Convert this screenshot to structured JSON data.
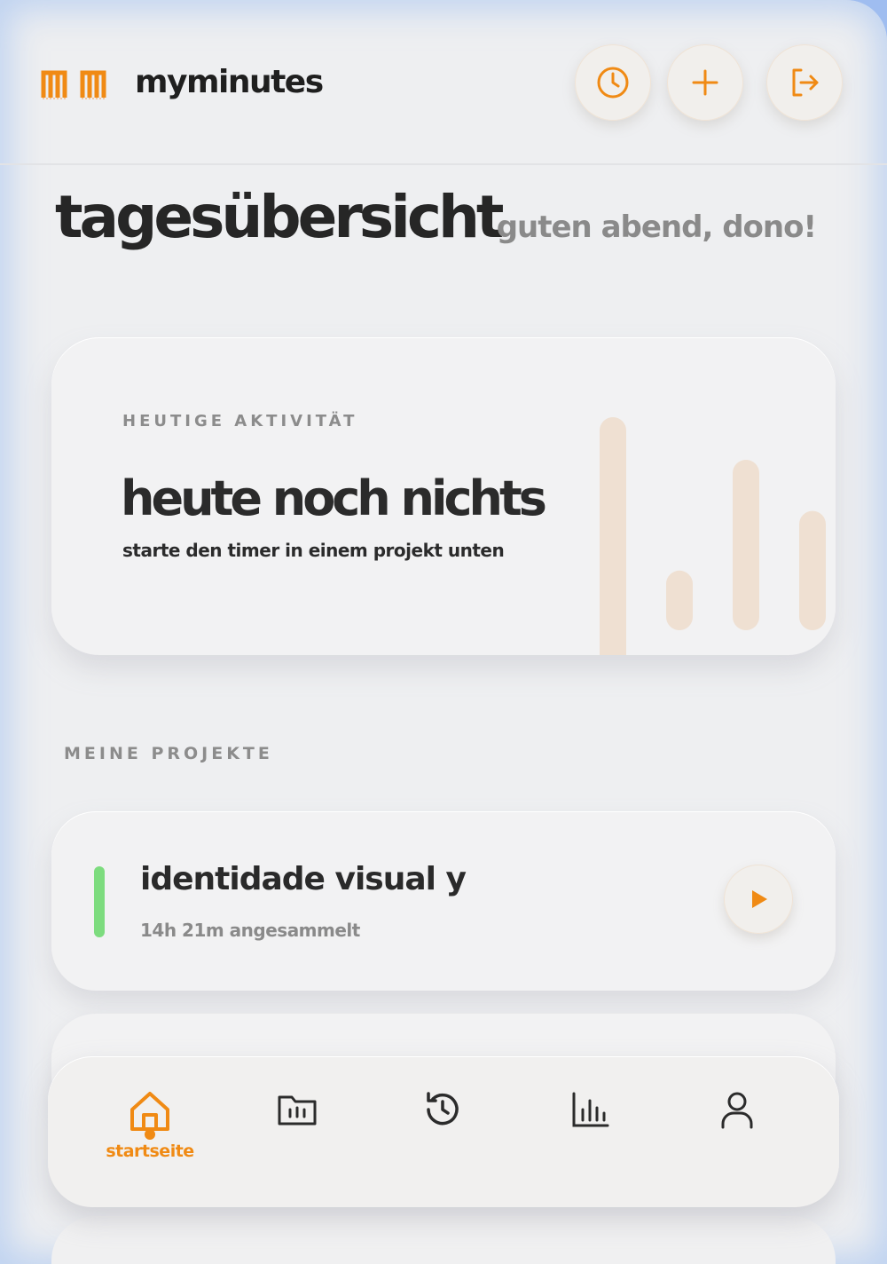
{
  "header": {
    "app_title": "myminutes",
    "buttons": [
      {
        "name": "clock-icon"
      },
      {
        "name": "plus-icon"
      },
      {
        "name": "logout-icon"
      }
    ]
  },
  "dashboard": {
    "title": "tagesübersicht",
    "greeting": "guten abend, dono!"
  },
  "activity": {
    "overline": "HEUTIGE AKTIVITÄT",
    "headline": "heute noch nichts",
    "subtitle": "starte den timer in einem projekt unten",
    "decor_bar_levels": [
      1.0,
      0.28,
      0.8,
      0.56
    ]
  },
  "projects": {
    "section_label": "MEINE PROJEKTE",
    "items": [
      {
        "name": "identidade visual y",
        "time": "14h 21m angesammelt",
        "color": "#7ddc7e"
      }
    ]
  },
  "nav": {
    "active_label": "startseite",
    "items": [
      {
        "icon": "home-icon",
        "active": true
      },
      {
        "icon": "folder-icon",
        "active": false
      },
      {
        "icon": "history-icon",
        "active": false
      },
      {
        "icon": "stats-icon",
        "active": false
      },
      {
        "icon": "user-icon",
        "active": false
      }
    ]
  },
  "colors": {
    "accent": "#f08a14",
    "bar_decor": "#efe0d2",
    "text_dark": "#262626",
    "text_muted": "#8a8a8a"
  }
}
